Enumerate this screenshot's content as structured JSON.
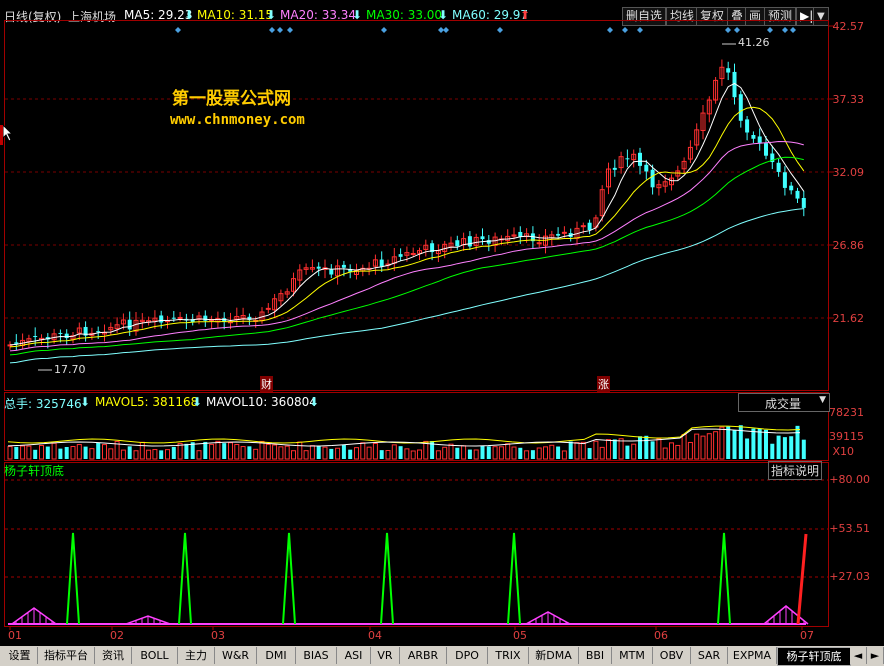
{
  "header": {
    "chart_mode": "日线(复权)",
    "stock_name": "上海机场",
    "ma": [
      {
        "label": "MA5: 29.23",
        "color": "#ffffff"
      },
      {
        "label": "MA10: 31.15",
        "color": "#ffff00"
      },
      {
        "label": "MA20: 33.34",
        "color": "#ff80ff"
      },
      {
        "label": "MA30: 33.00",
        "color": "#00ff00"
      },
      {
        "label": "MA60: 29.97",
        "color": "#80ffff"
      }
    ],
    "down_arrow": "⬇",
    "up_arrow": "⬆",
    "buttons": [
      "删自选",
      "均线",
      "复权",
      "叠",
      "画",
      "预测"
    ],
    "menu_arrow": "▼",
    "nav_icon": "▶|"
  },
  "price_axis": [
    "42.57",
    "37.33",
    "32.09",
    "26.86",
    "21.62"
  ],
  "annotations": {
    "high": "41.26",
    "low": "17.70",
    "cai_badge": "财",
    "zhang_badge": "涨"
  },
  "watermark": {
    "title": "第一股票公式网",
    "url": "www.chnmoney.com"
  },
  "volume_panel": {
    "total": "总手: 325746",
    "mavol5": "MAVOL5: 381168",
    "mavol10": "MAVOL10: 360804",
    "selector": "成交量",
    "axis": [
      "78231",
      "39115",
      "X10"
    ]
  },
  "indicator_panel": {
    "name": "杨子轩顶底",
    "help_button": "指标说明",
    "axis": [
      "+80.00",
      "+53.51",
      "+27.03"
    ]
  },
  "x_axis": [
    "01",
    "02",
    "03",
    "04",
    "05",
    "06",
    "07"
  ],
  "tabs": [
    "设置",
    "指标平台",
    "资讯",
    "BOLL",
    "主力",
    "W&R",
    "DMI",
    "BIAS",
    "ASI",
    "VR",
    "ARBR",
    "DPO",
    "TRIX",
    "新DMA",
    "BBI",
    "MTM",
    "OBV",
    "SAR",
    "EXPMA",
    "杨子轩顶底"
  ],
  "tab_scroll": [
    "◄",
    "►"
  ]
}
